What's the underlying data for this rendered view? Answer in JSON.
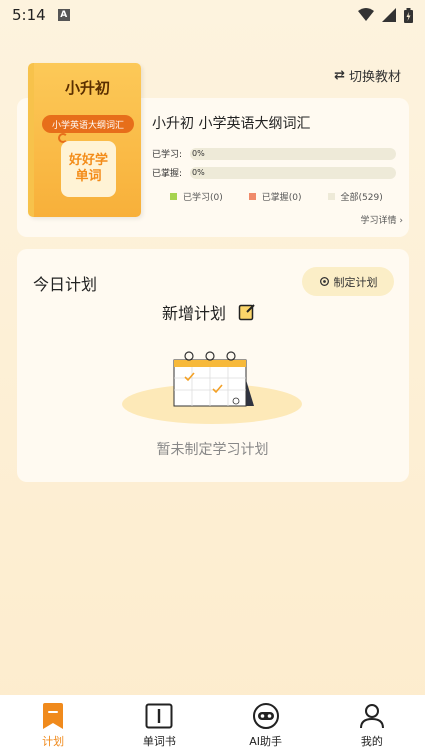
{
  "status": {
    "time": "5:14",
    "a_badge": "A"
  },
  "header": {
    "switch_label": "切换教材"
  },
  "book": {
    "cover_title": "小升初",
    "cover_tag": "小学英语大纲词汇",
    "cover_logo_line1": "好好学",
    "cover_logo_line2": "单词",
    "name": "小升初 小学英语大纲词汇",
    "learned_label": "已学习:",
    "learned_value": "0%",
    "learned_fraction": 0,
    "mastered_label": "已掌握:",
    "mastered_value": "0%",
    "mastered_fraction": 0,
    "legend": [
      {
        "label": "已学习(0)",
        "color": "#a6d34f"
      },
      {
        "label": "已掌握(0)",
        "color": "#f08a6a"
      },
      {
        "label": "全部(529)",
        "color": "#eeead8"
      }
    ],
    "detail_link": "学习详情"
  },
  "plan": {
    "title": "今日计划",
    "make_plan_label": "制定计划",
    "new_plan_label": "新增计划",
    "empty_text": "暂未制定学习计划"
  },
  "tabs": [
    {
      "label": "计划",
      "icon": "bookmark-icon",
      "active": true
    },
    {
      "label": "单词书",
      "icon": "book-icon",
      "active": false
    },
    {
      "label": "AI助手",
      "icon": "robot-icon",
      "active": false
    },
    {
      "label": "我的",
      "icon": "person-icon",
      "active": false
    }
  ],
  "colors": {
    "accent": "#f08a1c",
    "background": "#fdf0d5",
    "card": "#fffaf1"
  }
}
